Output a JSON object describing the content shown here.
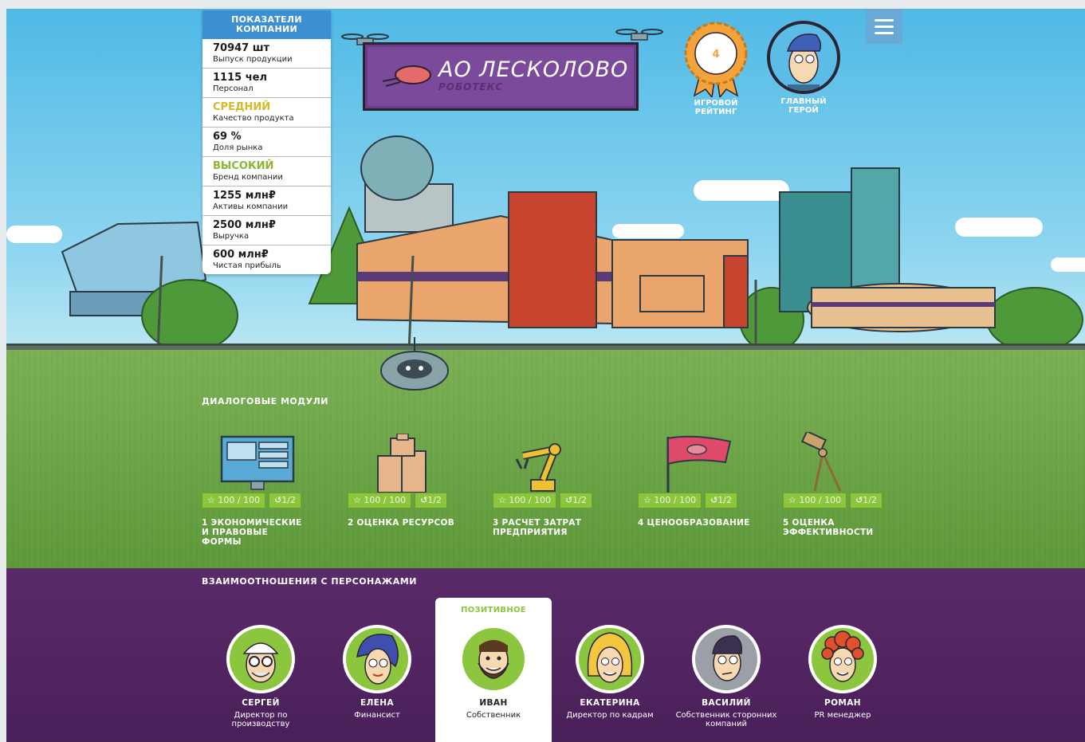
{
  "stats_panel": {
    "title": "ПОКАЗАТЕЛИ КОМПАНИИ",
    "items": [
      {
        "value": "70947 шт",
        "label": "Выпуск продукции"
      },
      {
        "value": "1115 чел",
        "label": "Персонал"
      },
      {
        "value": "СРЕДНИЙ",
        "label": "Качество продукта"
      },
      {
        "value": "69 %",
        "label": "Доля рынка"
      },
      {
        "value": "ВЫСОКИЙ",
        "label": "Бренд компании"
      },
      {
        "value": "1255 млн₽",
        "label": "Активы компании"
      },
      {
        "value": "2500 млн₽",
        "label": "Выручка"
      },
      {
        "value": "600 млн₽",
        "label": "Чистая прибыль"
      }
    ]
  },
  "banner": {
    "title": "АО ЛЕСКОЛОВО",
    "subtitle": "РОБОТЕКС"
  },
  "rating": {
    "value": "4",
    "caption": "ИГРОВОЙ РЕЙТИНГ"
  },
  "hero": {
    "caption": "ГЛАВНЫЙ ГЕРОЙ"
  },
  "modules_section": {
    "title": "ДИАЛОГОВЫЕ МОДУЛИ"
  },
  "modules": [
    {
      "name": "1 ЭКОНОМИЧЕСКИЕ И ПРАВОВЫЕ ФОРМЫ",
      "score": "100 / 100",
      "attempts": "1/2",
      "icon": "monitor-icon"
    },
    {
      "name": "2 ОЦЕНКА РЕСУРСОВ",
      "score": "100 / 100",
      "attempts": "1/2",
      "icon": "boxes-icon"
    },
    {
      "name": "3 РАСЧЕТ ЗАТРАТ ПРЕДПРИЯТИЯ",
      "score": "100 / 100",
      "attempts": "1/2",
      "icon": "robot-arm-icon"
    },
    {
      "name": "4 ЦЕНООБРАЗОВАНИЕ",
      "score": "100 / 100",
      "attempts": "1/2",
      "icon": "flag-icon"
    },
    {
      "name": "5 ОЦЕНКА ЭФФЕКТИВНОСТИ",
      "score": "100 / 100",
      "attempts": "1/2",
      "icon": "telescope-icon"
    }
  ],
  "characters_section": {
    "title": "ВЗАИМООТНОШЕНИЯ С ПЕРСОНАЖАМИ"
  },
  "characters": [
    {
      "name": "СЕРГЕЙ",
      "role": "Директор по производству"
    },
    {
      "name": "ЕЛЕНА",
      "role": "Финансист"
    },
    {
      "name": "ИВАН",
      "role": "Собственник",
      "status": "ПОЗИТИВНОЕ"
    },
    {
      "name": "ЕКАТЕРИНА",
      "role": "Директор по кадрам"
    },
    {
      "name": "ВАСИЛИЙ",
      "role": "Собственник сторонних компаний"
    },
    {
      "name": "РОМАН",
      "role": "PR менеджер"
    }
  ],
  "colors": {
    "accent_green": "#8cc63f",
    "purple": "#4a2059",
    "stats_header": "#3c8fd0",
    "gold": "#d4b928"
  }
}
